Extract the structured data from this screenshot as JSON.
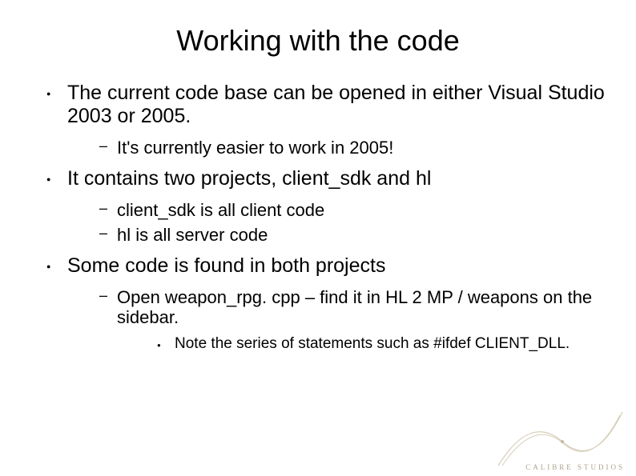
{
  "title": "Working with the code",
  "bullets": [
    {
      "text": "The current code base can be opened in either Visual Studio 2003 or 2005.",
      "sub": [
        {
          "text": "It's currently easier to work in 2005!"
        }
      ]
    },
    {
      "text": "It contains two projects, client_sdk and hl",
      "sub": [
        {
          "text": "client_sdk is all client code"
        },
        {
          "text": "hl is all server code"
        }
      ]
    },
    {
      "text": "Some code is found in both projects",
      "sub": [
        {
          "text": "Open weapon_rpg. cpp – find it in HL 2 MP / weapons on the sidebar.",
          "sub": [
            {
              "text": "Note the series of statements such as #ifdef CLIENT_DLL."
            }
          ]
        }
      ]
    }
  ],
  "logo_text": "CALIBRE STUDIOS"
}
